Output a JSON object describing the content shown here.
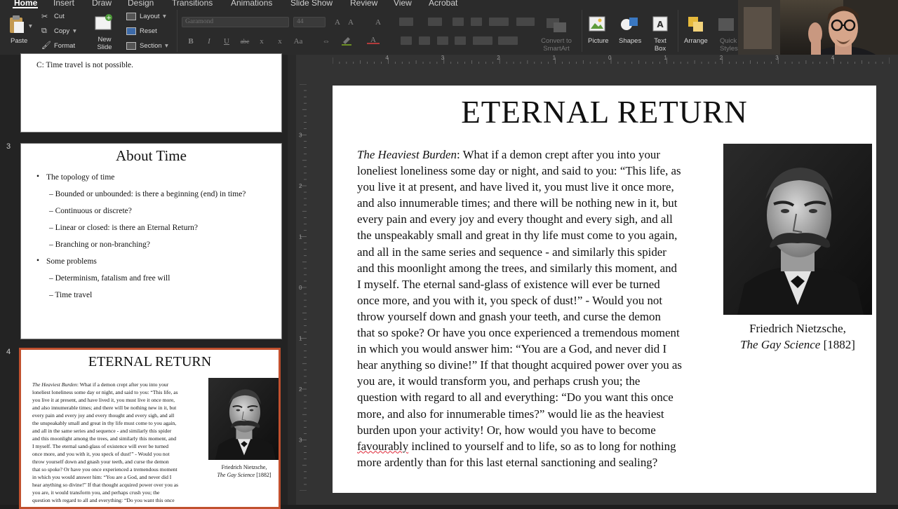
{
  "ribbon": {
    "tabs": [
      "Home",
      "Insert",
      "Draw",
      "Design",
      "Transitions",
      "Animations",
      "Slide Show",
      "Review",
      "View",
      "Acrobat"
    ],
    "paste_label": "Paste",
    "cut_label": "Cut",
    "copy_label": "Copy",
    "format_label": "Format",
    "new_slide_line1": "New",
    "new_slide_line2": "Slide",
    "layout_label": "Layout",
    "reset_label": "Reset",
    "section_label": "Section",
    "font_name": "Garamond",
    "font_size": "44",
    "convert_line1": "Convert to",
    "convert_line2": "SmartArt",
    "picture_label": "Picture",
    "shapes_label": "Shapes",
    "textbox_line1": "Text",
    "textbox_line2": "Box",
    "arrange_label": "Arrange",
    "quick_line1": "Quick",
    "quick_line2": "Styles"
  },
  "thumbnails": {
    "slide2": {
      "text": "C:  Time travel is not possible."
    },
    "slide3": {
      "number": "3",
      "title": "About Time",
      "bullets": [
        "The topology of time",
        "– Bounded or unbounded: is there a beginning (end) in time?",
        "– Continuous or discrete?",
        "– Linear or closed: is there an Eternal Return?",
        "– Branching or non-branching?",
        "Some problems",
        "– Determinism, fatalism and free will",
        "– Time travel"
      ]
    },
    "slide4": {
      "number": "4",
      "title": "ETERNAL RETURN",
      "caption_line1": "Friedrich Nietzsche,",
      "caption_italic": "The Gay Science",
      "caption_year": " [1882]"
    }
  },
  "slide": {
    "title": "ETERNAL RETURN",
    "body_italic": "The Heaviest Burden",
    "body_lines": [
      ": What if  a demon crept after you into your",
      "loneliest loneliness some day or night, and said to you: “This life, as",
      "you live it at present, and have lived it, you must live it once more,",
      "and also innumerable times; and there will be nothing new in it, but",
      "every pain and every joy and every thought and every sigh, and all",
      "the unspeakably small and great in thy life must come to you again,",
      "and all in the same series and sequence - and similarly this spider",
      "and this moonlight among the trees, and similarly this moment, and",
      "I myself. The eternal sand-glass of existence will ever be turned",
      "once more, and you with it, you speck of dust!” - Would you not",
      "throw yourself  down and gnash your teeth, and curse the demon",
      "that so spoke? Or have you once experienced a tremendous moment",
      "in which you would answer him: “You are a God, and never did I",
      "hear anything so divine!” If  that thought acquired power over you as",
      "you are, it would transform you, and perhaps crush you; the",
      "question with regard to all and everything: “Do you want this once",
      "more, and also for innumerable times?” would lie as the heaviest",
      "burden upon your activity! Or, how would you have to become"
    ],
    "body_ul_word": "favourably",
    "body_line19_rest": " inclined to yourself  and to life, so as to long for nothing",
    "body_line20": "more ardently than for this last eternal sanctioning and sealing?",
    "caption_line1": "Friedrich Nietzsche,",
    "caption_italic": "The Gay Science",
    "caption_year": " [1882]"
  },
  "ruler": {
    "h_labels": [
      "4",
      "3",
      "2",
      "1",
      "0",
      "1",
      "2",
      "3",
      "4"
    ],
    "v_labels": [
      "3",
      "2",
      "1",
      "0",
      "1",
      "2",
      "3"
    ]
  }
}
